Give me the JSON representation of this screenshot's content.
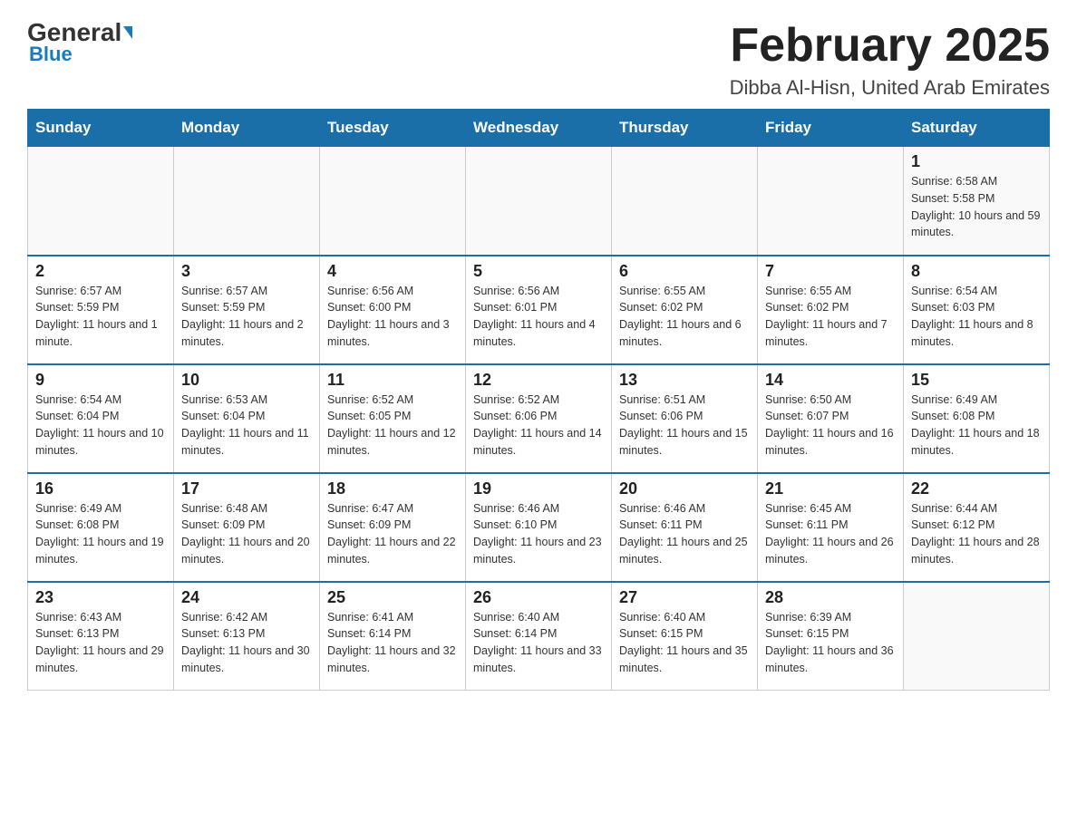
{
  "header": {
    "logo_general": "General",
    "logo_blue": "Blue",
    "month_title": "February 2025",
    "location": "Dibba Al-Hisn, United Arab Emirates"
  },
  "days_of_week": [
    "Sunday",
    "Monday",
    "Tuesday",
    "Wednesday",
    "Thursday",
    "Friday",
    "Saturday"
  ],
  "weeks": [
    {
      "days": [
        {
          "number": "",
          "info": ""
        },
        {
          "number": "",
          "info": ""
        },
        {
          "number": "",
          "info": ""
        },
        {
          "number": "",
          "info": ""
        },
        {
          "number": "",
          "info": ""
        },
        {
          "number": "",
          "info": ""
        },
        {
          "number": "1",
          "info": "Sunrise: 6:58 AM\nSunset: 5:58 PM\nDaylight: 10 hours and 59 minutes."
        }
      ]
    },
    {
      "days": [
        {
          "number": "2",
          "info": "Sunrise: 6:57 AM\nSunset: 5:59 PM\nDaylight: 11 hours and 1 minute."
        },
        {
          "number": "3",
          "info": "Sunrise: 6:57 AM\nSunset: 5:59 PM\nDaylight: 11 hours and 2 minutes."
        },
        {
          "number": "4",
          "info": "Sunrise: 6:56 AM\nSunset: 6:00 PM\nDaylight: 11 hours and 3 minutes."
        },
        {
          "number": "5",
          "info": "Sunrise: 6:56 AM\nSunset: 6:01 PM\nDaylight: 11 hours and 4 minutes."
        },
        {
          "number": "6",
          "info": "Sunrise: 6:55 AM\nSunset: 6:02 PM\nDaylight: 11 hours and 6 minutes."
        },
        {
          "number": "7",
          "info": "Sunrise: 6:55 AM\nSunset: 6:02 PM\nDaylight: 11 hours and 7 minutes."
        },
        {
          "number": "8",
          "info": "Sunrise: 6:54 AM\nSunset: 6:03 PM\nDaylight: 11 hours and 8 minutes."
        }
      ]
    },
    {
      "days": [
        {
          "number": "9",
          "info": "Sunrise: 6:54 AM\nSunset: 6:04 PM\nDaylight: 11 hours and 10 minutes."
        },
        {
          "number": "10",
          "info": "Sunrise: 6:53 AM\nSunset: 6:04 PM\nDaylight: 11 hours and 11 minutes."
        },
        {
          "number": "11",
          "info": "Sunrise: 6:52 AM\nSunset: 6:05 PM\nDaylight: 11 hours and 12 minutes."
        },
        {
          "number": "12",
          "info": "Sunrise: 6:52 AM\nSunset: 6:06 PM\nDaylight: 11 hours and 14 minutes."
        },
        {
          "number": "13",
          "info": "Sunrise: 6:51 AM\nSunset: 6:06 PM\nDaylight: 11 hours and 15 minutes."
        },
        {
          "number": "14",
          "info": "Sunrise: 6:50 AM\nSunset: 6:07 PM\nDaylight: 11 hours and 16 minutes."
        },
        {
          "number": "15",
          "info": "Sunrise: 6:49 AM\nSunset: 6:08 PM\nDaylight: 11 hours and 18 minutes."
        }
      ]
    },
    {
      "days": [
        {
          "number": "16",
          "info": "Sunrise: 6:49 AM\nSunset: 6:08 PM\nDaylight: 11 hours and 19 minutes."
        },
        {
          "number": "17",
          "info": "Sunrise: 6:48 AM\nSunset: 6:09 PM\nDaylight: 11 hours and 20 minutes."
        },
        {
          "number": "18",
          "info": "Sunrise: 6:47 AM\nSunset: 6:09 PM\nDaylight: 11 hours and 22 minutes."
        },
        {
          "number": "19",
          "info": "Sunrise: 6:46 AM\nSunset: 6:10 PM\nDaylight: 11 hours and 23 minutes."
        },
        {
          "number": "20",
          "info": "Sunrise: 6:46 AM\nSunset: 6:11 PM\nDaylight: 11 hours and 25 minutes."
        },
        {
          "number": "21",
          "info": "Sunrise: 6:45 AM\nSunset: 6:11 PM\nDaylight: 11 hours and 26 minutes."
        },
        {
          "number": "22",
          "info": "Sunrise: 6:44 AM\nSunset: 6:12 PM\nDaylight: 11 hours and 28 minutes."
        }
      ]
    },
    {
      "days": [
        {
          "number": "23",
          "info": "Sunrise: 6:43 AM\nSunset: 6:13 PM\nDaylight: 11 hours and 29 minutes."
        },
        {
          "number": "24",
          "info": "Sunrise: 6:42 AM\nSunset: 6:13 PM\nDaylight: 11 hours and 30 minutes."
        },
        {
          "number": "25",
          "info": "Sunrise: 6:41 AM\nSunset: 6:14 PM\nDaylight: 11 hours and 32 minutes."
        },
        {
          "number": "26",
          "info": "Sunrise: 6:40 AM\nSunset: 6:14 PM\nDaylight: 11 hours and 33 minutes."
        },
        {
          "number": "27",
          "info": "Sunrise: 6:40 AM\nSunset: 6:15 PM\nDaylight: 11 hours and 35 minutes."
        },
        {
          "number": "28",
          "info": "Sunrise: 6:39 AM\nSunset: 6:15 PM\nDaylight: 11 hours and 36 minutes."
        },
        {
          "number": "",
          "info": ""
        }
      ]
    }
  ]
}
